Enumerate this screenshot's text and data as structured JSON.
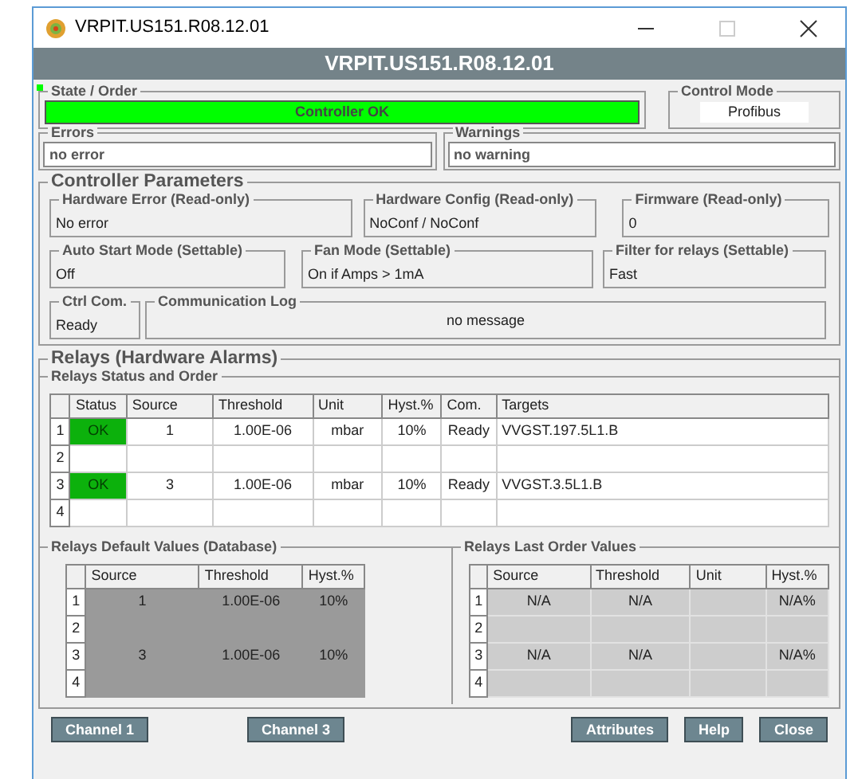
{
  "window": {
    "title": "VRPIT.US151.R08.12.01"
  },
  "header": "VRPIT.US151.R08.12.01",
  "state_order": {
    "label": "State / Order",
    "value": "Controller OK",
    "ok": true
  },
  "control_mode": {
    "label": "Control Mode",
    "value": "Profibus"
  },
  "errors": {
    "label": "Errors",
    "value": "no error"
  },
  "warnings": {
    "label": "Warnings",
    "value": "no warning"
  },
  "controller_parameters": {
    "title": "Controller Parameters",
    "rows": [
      [
        {
          "label": "Hardware Error (Read-only)",
          "value": "No error"
        },
        {
          "label": "Hardware Config (Read-only)",
          "value": "NoConf / NoConf"
        },
        {
          "label": "Firmware (Read-only)",
          "value": "0"
        }
      ],
      [
        {
          "label": "Auto Start Mode (Settable)",
          "value": "Off"
        },
        {
          "label": "Fan Mode (Settable)",
          "value": "On if Amps > 1mA"
        },
        {
          "label": "Filter for relays (Settable)",
          "value": "Fast"
        }
      ],
      [
        {
          "label": "Ctrl Com.",
          "value": "Ready"
        },
        {
          "label": "Communication Log",
          "value": "no message",
          "centered": true
        }
      ]
    ]
  },
  "relays": {
    "title": "Relays (Hardware Alarms)",
    "status_order": {
      "title": "Relays Status and Order",
      "columns": [
        "Status",
        "Source",
        "Threshold",
        "Unit",
        "Hyst.%",
        "Com.",
        "Targets"
      ],
      "rows": [
        {
          "number": "1",
          "ok": true,
          "cells": [
            "OK",
            "1",
            "1.00E-06",
            "mbar",
            "10%",
            "Ready",
            "VVGST.197.5L1.B"
          ]
        },
        {
          "number": "2",
          "ok": false
        },
        {
          "number": "3",
          "ok": true,
          "cells": [
            "OK",
            "3",
            "1.00E-06",
            "mbar",
            "10%",
            "Ready",
            "VVGST.3.5L1.B"
          ]
        },
        {
          "number": "4",
          "ok": false
        }
      ]
    },
    "default_values": {
      "title": "Relays Default Values (Database)",
      "columns": [
        "Source",
        "Threshold",
        "Hyst.%"
      ],
      "rows": [
        {
          "number": "1",
          "cells": [
            "1",
            "1.00E-06",
            "10%"
          ]
        },
        {
          "number": "2"
        },
        {
          "number": "3",
          "cells": [
            "3",
            "1.00E-06",
            "10%"
          ]
        },
        {
          "number": "4"
        }
      ]
    },
    "last_order": {
      "title": "Relays Last Order Values",
      "columns": [
        "Source",
        "Threshold",
        "Unit",
        "Hyst.%"
      ],
      "rows": [
        {
          "number": "1",
          "cells": [
            "N/A",
            "N/A",
            null,
            "N/A%"
          ]
        },
        {
          "number": "2"
        },
        {
          "number": "3",
          "cells": [
            "N/A",
            "N/A",
            null,
            "N/A%"
          ]
        },
        {
          "number": "4"
        }
      ]
    }
  },
  "buttons_left": [
    "Channel 1",
    "Channel 3"
  ],
  "buttons_right": [
    "Attributes",
    "Help",
    "Close"
  ]
}
